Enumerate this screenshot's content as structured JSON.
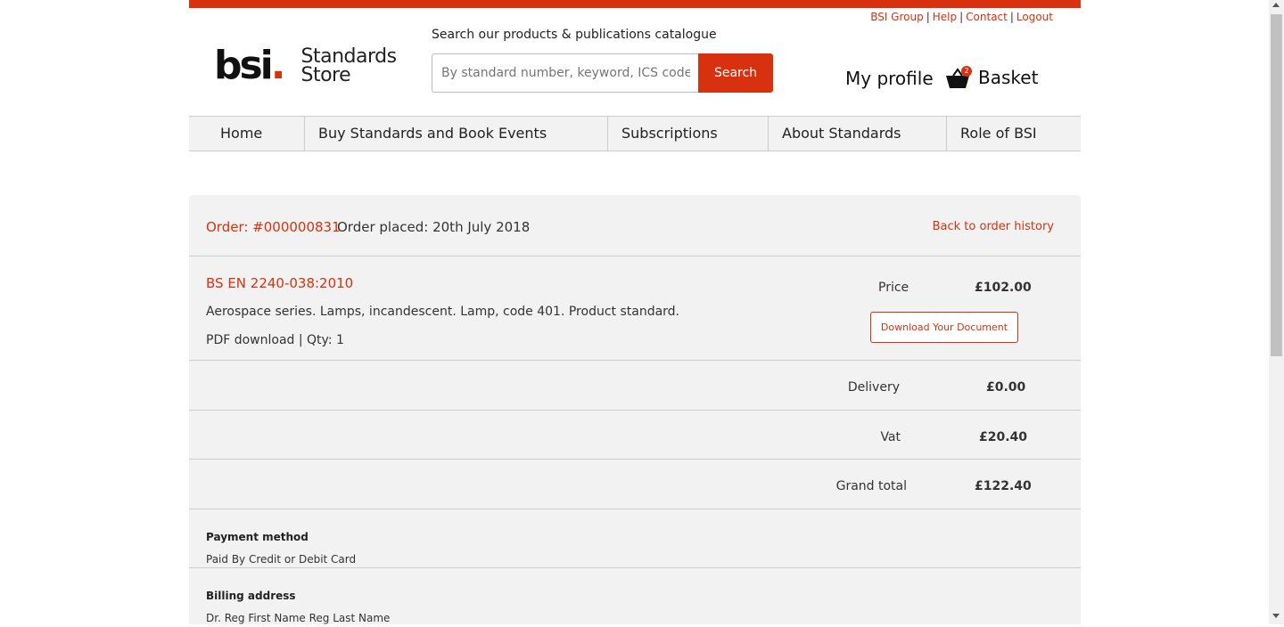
{
  "header": {
    "util_links": [
      "BSI Group",
      "Help",
      "Contact",
      "Logout"
    ],
    "logo_text": "bsi",
    "logo_dot": ".",
    "logo_store_line1": "Standards",
    "logo_store_line2": "Store",
    "search_label": "Search our products & publications catalogue",
    "search_placeholder": "By standard number, keyword, ICS code, ISBN",
    "search_button": "Search",
    "my_profile": "My profile",
    "basket_label": "Basket",
    "basket_count": "2"
  },
  "nav": {
    "items": [
      "Home",
      "Buy Standards and Book Events",
      "Subscriptions",
      "About Standards",
      "Role of BSI"
    ]
  },
  "order": {
    "number": "Order: #000000831",
    "placed": "Order placed: 20th July 2018",
    "back_link": "Back to order history",
    "item": {
      "code": "BS EN 2240-038:2010",
      "description": "Aerospace series. Lamps, incandescent. Lamp, code 401. Product standard.",
      "meta": "PDF download | Qty: 1",
      "price_label": "Price",
      "price": "£102.00",
      "download_button": "Download Your Document"
    },
    "delivery_label": "Delivery",
    "delivery": "£0.00",
    "vat_label": "Vat",
    "vat": "£20.40",
    "grand_total_label": "Grand total",
    "grand_total": "£122.40",
    "payment_title": "Payment method",
    "payment_text": "Paid By Credit or Debit Card",
    "billing_title": "Billing address",
    "billing_text": "Dr. Reg First Name Reg Last Name"
  },
  "colors": {
    "brand": "#d8310f",
    "panel": "#f2f2f2"
  },
  "icons": {
    "basket": "basket-icon"
  }
}
